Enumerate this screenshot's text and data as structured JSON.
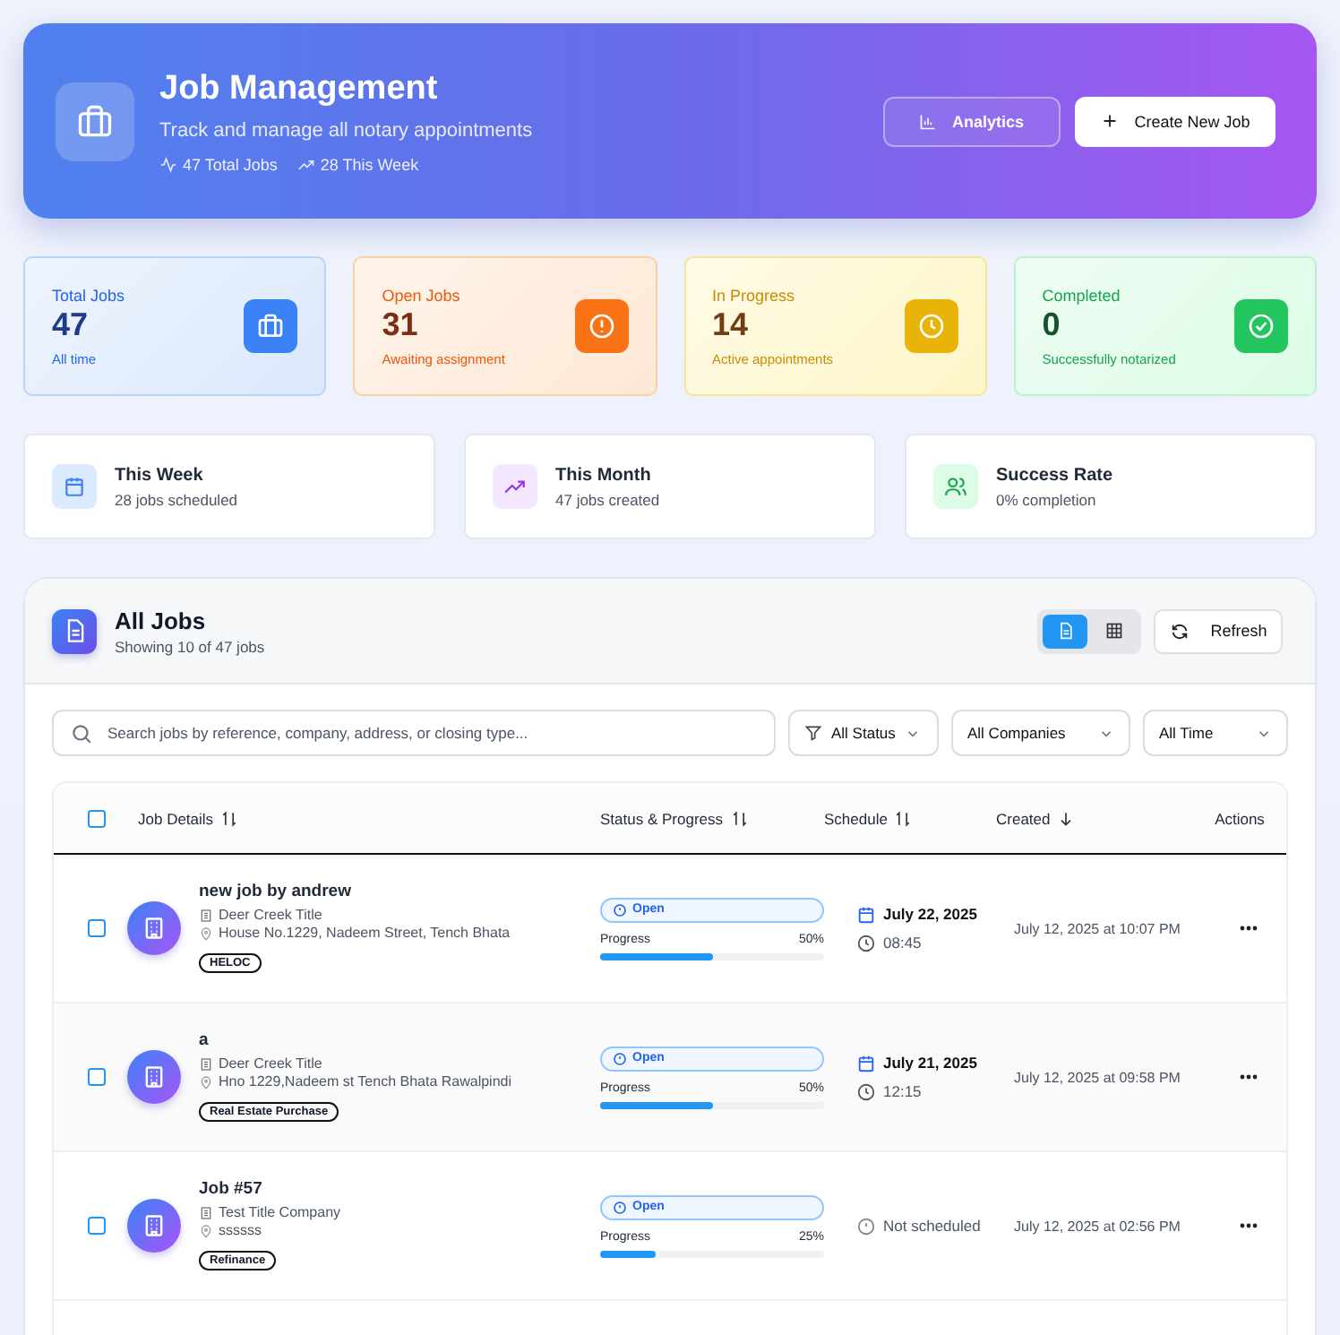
{
  "header": {
    "title": "Job Management",
    "subtitle": "Track and manage all notary appointments",
    "stats": [
      {
        "kind": "activity",
        "text": "47 Total Jobs"
      },
      {
        "kind": "trend",
        "text": "28 This Week"
      }
    ],
    "buttons": [
      {
        "kind": "analytics",
        "label": "Analytics"
      },
      {
        "kind": "create",
        "label": "Create New Job"
      }
    ]
  },
  "stat_cards": [
    {
      "kind": "total",
      "label": "Total Jobs",
      "value": "47",
      "caption": "All time"
    },
    {
      "kind": "open",
      "label": "Open Jobs",
      "value": "31",
      "caption": "Awaiting assignment"
    },
    {
      "kind": "progress",
      "label": "In Progress",
      "value": "14",
      "caption": "Active appointments"
    },
    {
      "kind": "completed",
      "label": "Completed",
      "value": "0",
      "caption": "Successfully notarized"
    }
  ],
  "info_cards": [
    {
      "kind": "week",
      "title": "This Week",
      "caption": "28 jobs scheduled"
    },
    {
      "kind": "month",
      "title": "This Month",
      "caption": "47 jobs created"
    },
    {
      "kind": "rate",
      "title": "Success Rate",
      "caption": "0% completion"
    }
  ],
  "jobs_panel": {
    "title": "All Jobs",
    "subtitle": "Showing 10 of 47 jobs",
    "views": [
      {
        "kind": "list",
        "selected": true
      },
      {
        "kind": "grid",
        "selected": false
      }
    ],
    "refresh": "Refresh",
    "search": {
      "placeholder": "Search jobs by reference, company, address, or closing type..."
    },
    "filters": [
      {
        "kind": "status",
        "label": "All Status"
      },
      {
        "kind": "plain",
        "label": "All Companies"
      },
      {
        "kind": "plain",
        "label": "All Time"
      }
    ],
    "table": {
      "select_all": {
        "checked": false
      },
      "columns": [
        {
          "label": "Job Details",
          "kind": "sortable"
        },
        {
          "label": "Status & Progress",
          "kind": "sortable"
        },
        {
          "label": "Schedule",
          "kind": "sortable"
        },
        {
          "label": "Created",
          "kind": "sorted"
        },
        {
          "label": "Actions",
          "kind": "plain"
        }
      ],
      "rows": [
        {
          "checked": false,
          "title": "new job by andrew",
          "company": "Deer Creek Title",
          "address": "House No.1229, Nadeem Street, Tench Bhata",
          "tag": "HELOC",
          "status": "Open",
          "progress_label": "Progress",
          "progress_text": "50%",
          "level": 0.5,
          "schedule": {
            "kind": "date",
            "date": "July 22, 2025",
            "time": "08:45"
          },
          "created": "July 12, 2025 at 10:07 PM"
        },
        {
          "checked": false,
          "title": "a",
          "company": "Deer Creek Title",
          "address": "Hno 1229,Nadeem st Tench Bhata Rawalpindi",
          "tag": "Real Estate Purchase",
          "status": "Open",
          "progress_label": "Progress",
          "progress_text": "50%",
          "level": 0.5,
          "schedule": {
            "kind": "date",
            "date": "July 21, 2025",
            "time": "12:15"
          },
          "created": "July 12, 2025 at 09:58 PM"
        },
        {
          "checked": false,
          "title": "Job #57",
          "company": "Test Title Company",
          "address": "ssssss",
          "tag": "Refinance",
          "status": "Open",
          "progress_label": "Progress",
          "progress_text": "25%",
          "level": 0.25,
          "schedule": {
            "kind": "none",
            "text": "Not scheduled"
          },
          "created": "July 12, 2025 at 02:56 PM"
        }
      ]
    }
  }
}
